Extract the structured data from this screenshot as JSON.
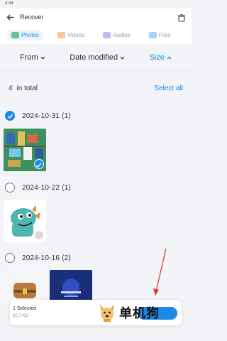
{
  "status": {
    "time": "4:44"
  },
  "app_bar": {
    "title": "Recover"
  },
  "tabs": [
    {
      "label": "Photos",
      "active": true,
      "icon": "photo-icon"
    },
    {
      "label": "Videos",
      "active": false,
      "icon": "video-icon"
    },
    {
      "label": "Audios",
      "active": false,
      "icon": "audio-icon"
    },
    {
      "label": "Files",
      "active": false,
      "icon": "file-icon"
    }
  ],
  "filters": {
    "from": "From",
    "date_modified": "Date modified",
    "size": "Size"
  },
  "summary": {
    "count": "4",
    "total_label": "in total",
    "select_all": "Select all"
  },
  "groups": [
    {
      "date": "2024-10-31 (1)",
      "checked": true
    },
    {
      "date": "2024-10-22 (1)",
      "checked": false
    },
    {
      "date": "2024-10-16 (2)",
      "checked": false
    }
  ],
  "bottom": {
    "selected": "1 Selected",
    "size": "80.7 KB",
    "watermark": "单机狗"
  },
  "colors": {
    "accent": "#1e88e5",
    "arrow": "#e53935"
  }
}
